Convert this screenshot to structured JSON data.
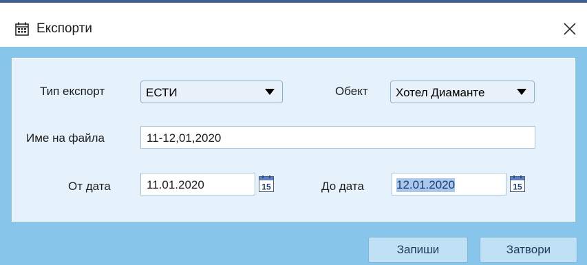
{
  "window": {
    "title": "Експорти",
    "icon": "calendar-grid-icon",
    "close_icon": "close-icon"
  },
  "form": {
    "export_type": {
      "label": "Тип експорт",
      "value": "ЕСТИ"
    },
    "object": {
      "label": "Обект",
      "value": "Хотел Диаманте"
    },
    "file_name": {
      "label": "Име на файла",
      "value": "11-12,01,2020"
    },
    "from_date": {
      "label": "От дата",
      "value": "11.01.2020",
      "calendar_day": "15"
    },
    "to_date": {
      "label": "До дата",
      "value": "12.01.2020",
      "calendar_day": "15"
    }
  },
  "buttons": {
    "save": "Запиши",
    "close": "Затвори"
  },
  "colors": {
    "frame": "#87c6ea",
    "panel": "#e5f1fb",
    "title_line": "#3f5f93",
    "selection": "#a8c8ec"
  }
}
